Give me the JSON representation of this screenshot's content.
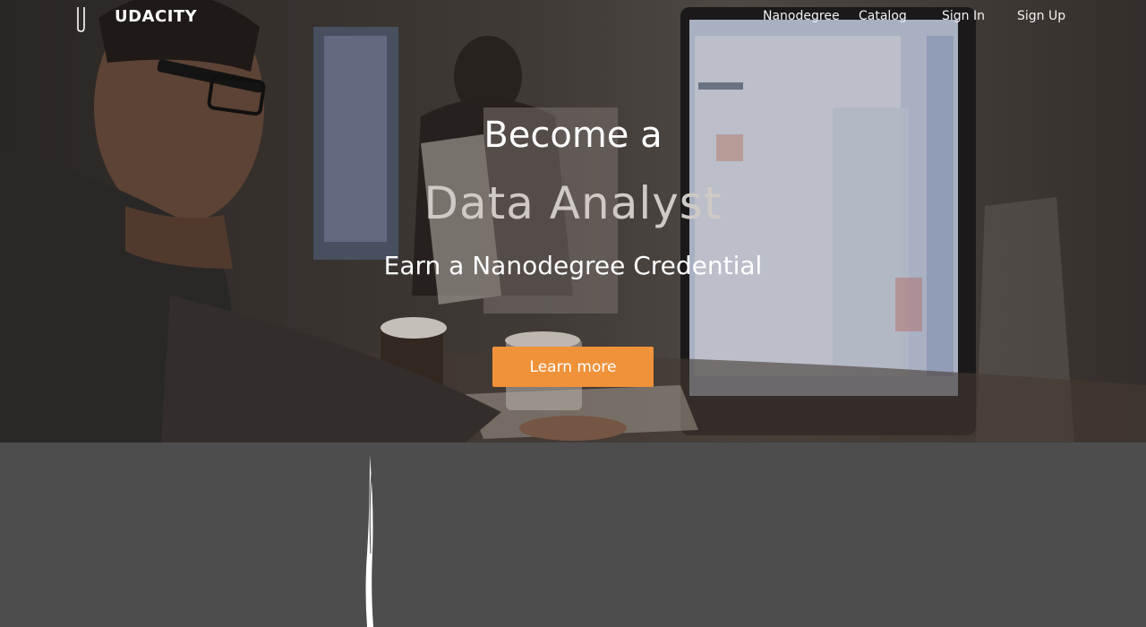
{
  "brand": {
    "name": "UDACITY",
    "logo_icon": "udacity-u-icon"
  },
  "nav": {
    "items": [
      {
        "label": "Nanodegree"
      },
      {
        "label": "Catalog"
      },
      {
        "label": "Sign In"
      },
      {
        "label": "Sign Up"
      }
    ]
  },
  "hero": {
    "line1": "Become a",
    "role": "Data Analyst",
    "credential": "Earn a Nanodegree Credential",
    "cta_label": "Learn more"
  },
  "colors": {
    "accent": "#f0923a",
    "lower_background": "#4d4d4d",
    "text": "#ffffff"
  }
}
